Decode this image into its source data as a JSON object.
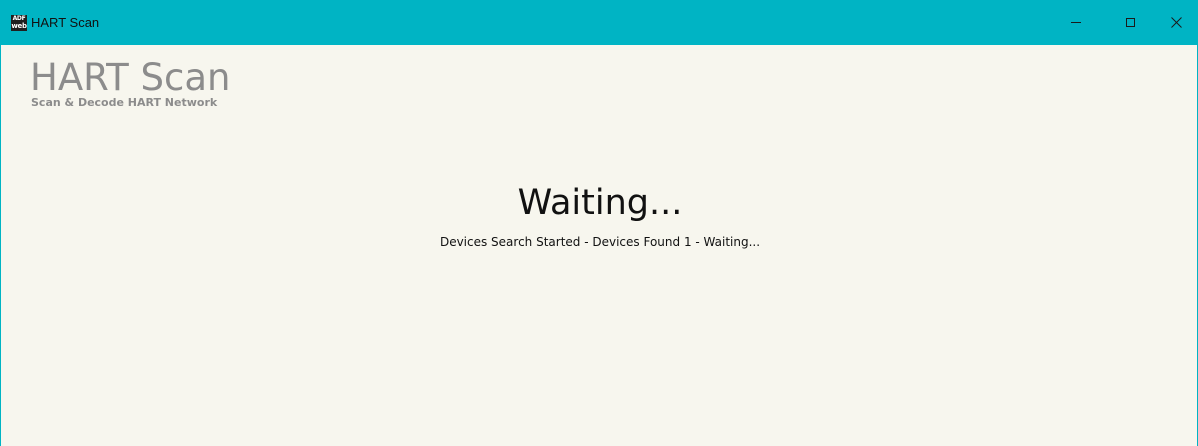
{
  "window": {
    "title": "HART Scan",
    "icon": {
      "name": "adfweb-app-icon",
      "top_text": "ADF",
      "bottom_text": "web"
    },
    "controls": {
      "minimize": "minimize-icon",
      "maximize": "maximize-icon",
      "close": "close-icon"
    },
    "accent_color": "#00b4c4",
    "background_color": "#f7f6ee"
  },
  "header": {
    "title": "HART Scan",
    "subtitle": "Scan & Decode HART Network"
  },
  "status": {
    "heading": "Waiting...",
    "detail": "Devices Search Started - Devices Found 1 - Waiting..."
  }
}
